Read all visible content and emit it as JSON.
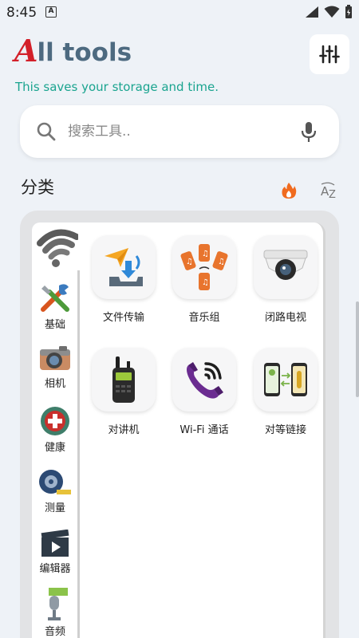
{
  "status_bar": {
    "time": "8:45",
    "notif_letter": "A"
  },
  "header": {
    "title_first": "A",
    "title_rest": "ll tools",
    "subtitle": "This saves your storage and time."
  },
  "search": {
    "placeholder": "搜索工具.."
  },
  "categories_title": "分类",
  "sidebar": {
    "items": [
      {
        "label": "",
        "icon": "wifi-icon",
        "active": true
      },
      {
        "label": "基础",
        "icon": "tools-icon"
      },
      {
        "label": "相机",
        "icon": "camera-icon"
      },
      {
        "label": "健康",
        "icon": "health-icon"
      },
      {
        "label": "测量",
        "icon": "tape-measure-icon"
      },
      {
        "label": "编辑器",
        "icon": "video-editor-icon"
      },
      {
        "label": "音频",
        "icon": "microphone-icon"
      }
    ]
  },
  "tools": [
    {
      "label": "文件传输",
      "icon": "file-transfer-icon"
    },
    {
      "label": "音乐组",
      "icon": "music-group-icon"
    },
    {
      "label": "闭路电视",
      "icon": "cctv-icon"
    },
    {
      "label": "对讲机",
      "icon": "walkie-talkie-icon"
    },
    {
      "label": "Wi-Fi 通话",
      "icon": "wifi-call-icon"
    },
    {
      "label": "对等链接",
      "icon": "peer-link-icon"
    }
  ],
  "colors": {
    "brand_red": "#d3202a",
    "title_slate": "#4d6a80",
    "subtitle_teal": "#1aa48f",
    "background": "#eef2f7"
  }
}
